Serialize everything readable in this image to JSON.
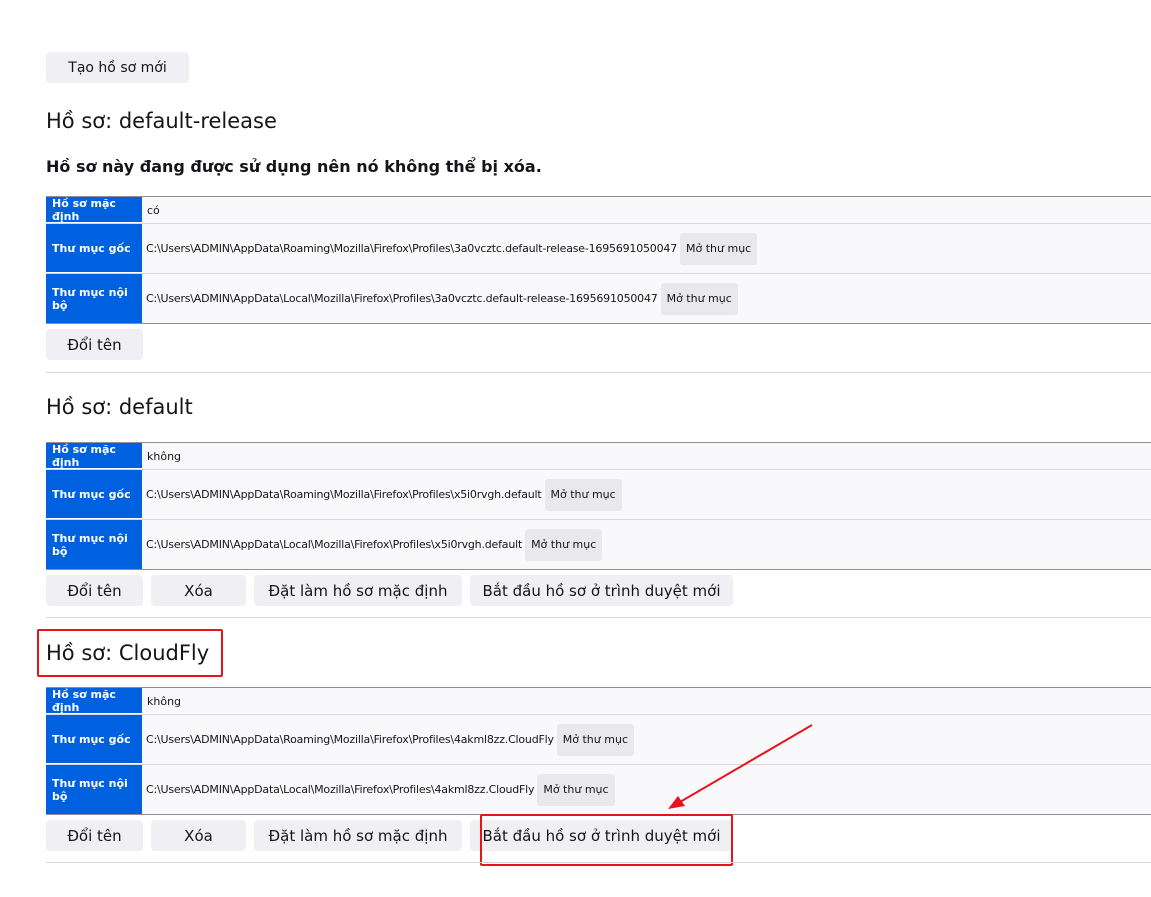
{
  "create_button": "Tạo hồ sơ mới",
  "labels": {
    "is_default": "Hồ sơ mặc định",
    "root_dir": "Thư mục gốc",
    "local_dir": "Thư mục nội bộ",
    "open_folder": "Mở thư mục"
  },
  "actions": {
    "rename": "Đổi tên",
    "remove": "Xóa",
    "set_default": "Đặt làm hồ sơ mặc định",
    "launch": "Bắt đầu hồ sơ ở trình duyệt mới"
  },
  "profiles": [
    {
      "title": "Hồ sơ: default-release",
      "note": "Hồ sơ này đang được sử dụng nên nó không thể bị xóa.",
      "is_default": "có",
      "root_dir": "C:\\Users\\ADMIN\\AppData\\Roaming\\Mozilla\\Firefox\\Profiles\\3a0vcztc.default-release-1695691050047",
      "local_dir": "C:\\Users\\ADMIN\\AppData\\Local\\Mozilla\\Firefox\\Profiles\\3a0vcztc.default-release-1695691050047"
    },
    {
      "title": "Hồ sơ: default",
      "is_default": "không",
      "root_dir": "C:\\Users\\ADMIN\\AppData\\Roaming\\Mozilla\\Firefox\\Profiles\\x5i0rvgh.default",
      "local_dir": "C:\\Users\\ADMIN\\AppData\\Local\\Mozilla\\Firefox\\Profiles\\x5i0rvgh.default"
    },
    {
      "title": "Hồ sơ: CloudFly",
      "is_default": "không",
      "root_dir": "C:\\Users\\ADMIN\\AppData\\Roaming\\Mozilla\\Firefox\\Profiles\\4akml8zz.CloudFly",
      "local_dir": "C:\\Users\\ADMIN\\AppData\\Local\\Mozilla\\Firefox\\Profiles\\4akml8zz.CloudFly"
    }
  ],
  "colors": {
    "header_cell": "#0061e0",
    "annotation": "#e8141b"
  }
}
